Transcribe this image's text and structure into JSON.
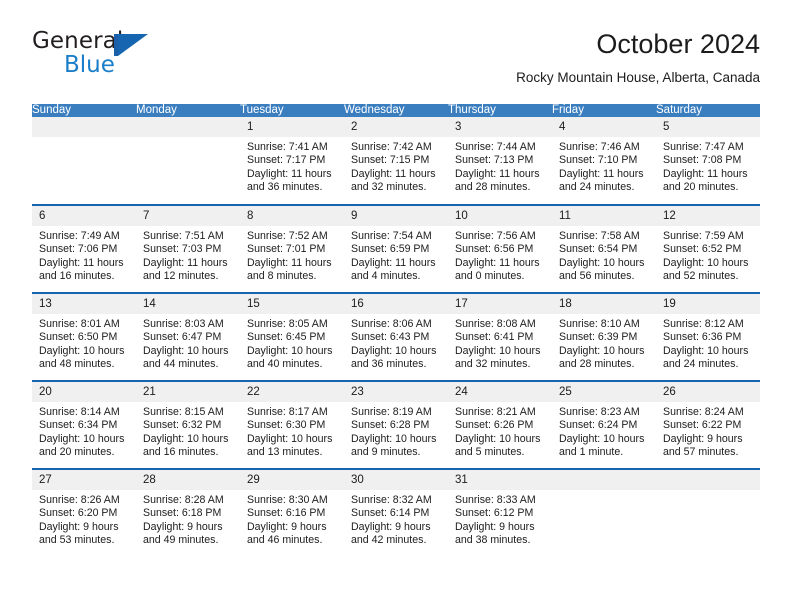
{
  "brand": {
    "name_part1": "General",
    "name_part2": "Blue",
    "flag_icon": "triangle-flag-icon",
    "accent_color": "#1565b0"
  },
  "header": {
    "title": "October 2024",
    "subtitle": "Rocky Mountain House, Alberta, Canada"
  },
  "colors": {
    "header_row_bg": "#3a7ec0",
    "header_row_text": "#ffffff",
    "daynum_bg": "#f0f0f0",
    "row_separator": "#1565b0",
    "cell_bg": "#ffffff",
    "text": "#1c1c1c"
  },
  "calendar": {
    "weekdays": [
      "Sunday",
      "Monday",
      "Tuesday",
      "Wednesday",
      "Thursday",
      "Friday",
      "Saturday"
    ],
    "labels": {
      "sunrise": "Sunrise:",
      "sunset": "Sunset:",
      "daylight": "Daylight:"
    },
    "weeks": [
      [
        {
          "day": "",
          "sunrise": "",
          "sunset": "",
          "daylight": "",
          "empty": true
        },
        {
          "day": "",
          "sunrise": "",
          "sunset": "",
          "daylight": "",
          "empty": true
        },
        {
          "day": "1",
          "sunrise": "Sunrise: 7:41 AM",
          "sunset": "Sunset: 7:17 PM",
          "daylight": "Daylight: 11 hours and 36 minutes.",
          "empty": false
        },
        {
          "day": "2",
          "sunrise": "Sunrise: 7:42 AM",
          "sunset": "Sunset: 7:15 PM",
          "daylight": "Daylight: 11 hours and 32 minutes.",
          "empty": false
        },
        {
          "day": "3",
          "sunrise": "Sunrise: 7:44 AM",
          "sunset": "Sunset: 7:13 PM",
          "daylight": "Daylight: 11 hours and 28 minutes.",
          "empty": false
        },
        {
          "day": "4",
          "sunrise": "Sunrise: 7:46 AM",
          "sunset": "Sunset: 7:10 PM",
          "daylight": "Daylight: 11 hours and 24 minutes.",
          "empty": false
        },
        {
          "day": "5",
          "sunrise": "Sunrise: 7:47 AM",
          "sunset": "Sunset: 7:08 PM",
          "daylight": "Daylight: 11 hours and 20 minutes.",
          "empty": false
        }
      ],
      [
        {
          "day": "6",
          "sunrise": "Sunrise: 7:49 AM",
          "sunset": "Sunset: 7:06 PM",
          "daylight": "Daylight: 11 hours and 16 minutes.",
          "empty": false
        },
        {
          "day": "7",
          "sunrise": "Sunrise: 7:51 AM",
          "sunset": "Sunset: 7:03 PM",
          "daylight": "Daylight: 11 hours and 12 minutes.",
          "empty": false
        },
        {
          "day": "8",
          "sunrise": "Sunrise: 7:52 AM",
          "sunset": "Sunset: 7:01 PM",
          "daylight": "Daylight: 11 hours and 8 minutes.",
          "empty": false
        },
        {
          "day": "9",
          "sunrise": "Sunrise: 7:54 AM",
          "sunset": "Sunset: 6:59 PM",
          "daylight": "Daylight: 11 hours and 4 minutes.",
          "empty": false
        },
        {
          "day": "10",
          "sunrise": "Sunrise: 7:56 AM",
          "sunset": "Sunset: 6:56 PM",
          "daylight": "Daylight: 11 hours and 0 minutes.",
          "empty": false
        },
        {
          "day": "11",
          "sunrise": "Sunrise: 7:58 AM",
          "sunset": "Sunset: 6:54 PM",
          "daylight": "Daylight: 10 hours and 56 minutes.",
          "empty": false
        },
        {
          "day": "12",
          "sunrise": "Sunrise: 7:59 AM",
          "sunset": "Sunset: 6:52 PM",
          "daylight": "Daylight: 10 hours and 52 minutes.",
          "empty": false
        }
      ],
      [
        {
          "day": "13",
          "sunrise": "Sunrise: 8:01 AM",
          "sunset": "Sunset: 6:50 PM",
          "daylight": "Daylight: 10 hours and 48 minutes.",
          "empty": false
        },
        {
          "day": "14",
          "sunrise": "Sunrise: 8:03 AM",
          "sunset": "Sunset: 6:47 PM",
          "daylight": "Daylight: 10 hours and 44 minutes.",
          "empty": false
        },
        {
          "day": "15",
          "sunrise": "Sunrise: 8:05 AM",
          "sunset": "Sunset: 6:45 PM",
          "daylight": "Daylight: 10 hours and 40 minutes.",
          "empty": false
        },
        {
          "day": "16",
          "sunrise": "Sunrise: 8:06 AM",
          "sunset": "Sunset: 6:43 PM",
          "daylight": "Daylight: 10 hours and 36 minutes.",
          "empty": false
        },
        {
          "day": "17",
          "sunrise": "Sunrise: 8:08 AM",
          "sunset": "Sunset: 6:41 PM",
          "daylight": "Daylight: 10 hours and 32 minutes.",
          "empty": false
        },
        {
          "day": "18",
          "sunrise": "Sunrise: 8:10 AM",
          "sunset": "Sunset: 6:39 PM",
          "daylight": "Daylight: 10 hours and 28 minutes.",
          "empty": false
        },
        {
          "day": "19",
          "sunrise": "Sunrise: 8:12 AM",
          "sunset": "Sunset: 6:36 PM",
          "daylight": "Daylight: 10 hours and 24 minutes.",
          "empty": false
        }
      ],
      [
        {
          "day": "20",
          "sunrise": "Sunrise: 8:14 AM",
          "sunset": "Sunset: 6:34 PM",
          "daylight": "Daylight: 10 hours and 20 minutes.",
          "empty": false
        },
        {
          "day": "21",
          "sunrise": "Sunrise: 8:15 AM",
          "sunset": "Sunset: 6:32 PM",
          "daylight": "Daylight: 10 hours and 16 minutes.",
          "empty": false
        },
        {
          "day": "22",
          "sunrise": "Sunrise: 8:17 AM",
          "sunset": "Sunset: 6:30 PM",
          "daylight": "Daylight: 10 hours and 13 minutes.",
          "empty": false
        },
        {
          "day": "23",
          "sunrise": "Sunrise: 8:19 AM",
          "sunset": "Sunset: 6:28 PM",
          "daylight": "Daylight: 10 hours and 9 minutes.",
          "empty": false
        },
        {
          "day": "24",
          "sunrise": "Sunrise: 8:21 AM",
          "sunset": "Sunset: 6:26 PM",
          "daylight": "Daylight: 10 hours and 5 minutes.",
          "empty": false
        },
        {
          "day": "25",
          "sunrise": "Sunrise: 8:23 AM",
          "sunset": "Sunset: 6:24 PM",
          "daylight": "Daylight: 10 hours and 1 minute.",
          "empty": false
        },
        {
          "day": "26",
          "sunrise": "Sunrise: 8:24 AM",
          "sunset": "Sunset: 6:22 PM",
          "daylight": "Daylight: 9 hours and 57 minutes.",
          "empty": false
        }
      ],
      [
        {
          "day": "27",
          "sunrise": "Sunrise: 8:26 AM",
          "sunset": "Sunset: 6:20 PM",
          "daylight": "Daylight: 9 hours and 53 minutes.",
          "empty": false
        },
        {
          "day": "28",
          "sunrise": "Sunrise: 8:28 AM",
          "sunset": "Sunset: 6:18 PM",
          "daylight": "Daylight: 9 hours and 49 minutes.",
          "empty": false
        },
        {
          "day": "29",
          "sunrise": "Sunrise: 8:30 AM",
          "sunset": "Sunset: 6:16 PM",
          "daylight": "Daylight: 9 hours and 46 minutes.",
          "empty": false
        },
        {
          "day": "30",
          "sunrise": "Sunrise: 8:32 AM",
          "sunset": "Sunset: 6:14 PM",
          "daylight": "Daylight: 9 hours and 42 minutes.",
          "empty": false
        },
        {
          "day": "31",
          "sunrise": "Sunrise: 8:33 AM",
          "sunset": "Sunset: 6:12 PM",
          "daylight": "Daylight: 9 hours and 38 minutes.",
          "empty": false
        },
        {
          "day": "",
          "sunrise": "",
          "sunset": "",
          "daylight": "",
          "empty": true
        },
        {
          "day": "",
          "sunrise": "",
          "sunset": "",
          "daylight": "",
          "empty": true
        }
      ]
    ]
  }
}
